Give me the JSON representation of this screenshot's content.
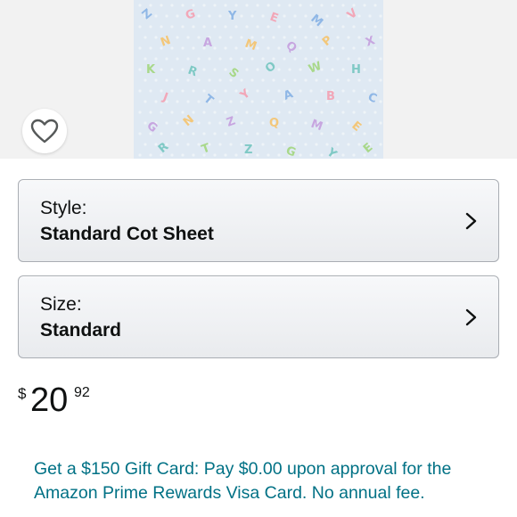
{
  "product_image": {
    "alt": "",
    "letters": [
      "Z",
      "G",
      "Y",
      "E",
      "M",
      "V",
      "N",
      "A",
      "M",
      "Q",
      "P",
      "X",
      "K",
      "R",
      "S",
      "O",
      "W",
      "H",
      "J",
      "T",
      "Y",
      "A",
      "B",
      "C",
      "G",
      "N",
      "Z",
      "Q",
      "M",
      "E",
      "R",
      "T"
    ]
  },
  "wishlist": {
    "icon": "heart-icon"
  },
  "style_selector": {
    "label": "Style:",
    "value": "Standard Cot Sheet",
    "icon": "chevron-right-icon"
  },
  "size_selector": {
    "label": "Size:",
    "value": "Standard",
    "icon": "chevron-right-icon"
  },
  "price": {
    "symbol": "$",
    "whole": "20",
    "fraction": "92"
  },
  "promo": {
    "text": "Get a $150 Gift Card: Pay $0.00 upon approval for the Amazon Prime Rewards Visa Card. No annual fee."
  },
  "colors": {
    "link": "#007185",
    "selector_border": "#a9adb3",
    "image_bg": "#dfe9f3"
  }
}
